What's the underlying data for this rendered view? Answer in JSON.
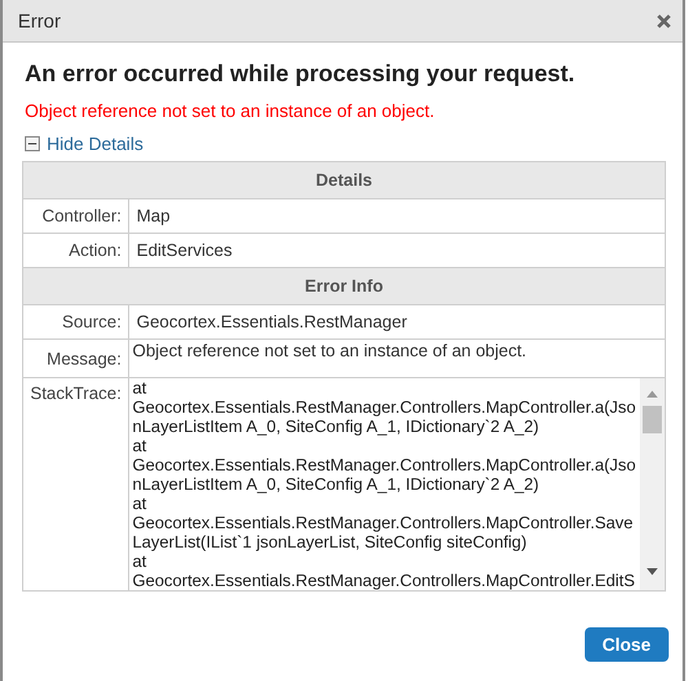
{
  "window": {
    "title": "Error"
  },
  "heading": "An error occurred while processing your request.",
  "message": "Object reference not set to an instance of an object.",
  "details_toggle": {
    "label": "Hide Details",
    "expanded": true
  },
  "sections": [
    {
      "title": "Details",
      "rows": [
        {
          "kind": "text",
          "label": "Controller:",
          "value": "Map"
        },
        {
          "kind": "text",
          "label": "Action:",
          "value": "EditServices"
        }
      ]
    },
    {
      "title": "Error Info",
      "rows": [
        {
          "kind": "text",
          "label": "Source:",
          "value": "Geocortex.Essentials.RestManager"
        },
        {
          "kind": "message",
          "label": "Message:",
          "value": "Object reference not set to an instance of an object."
        },
        {
          "kind": "trace",
          "label": "StackTrace:",
          "lines": [
            "at",
            "Geocortex.Essentials.RestManager.Controllers.MapController.a(Jso",
            "nLayerListItem A_0, SiteConfig A_1, IDictionary`2 A_2)",
            "at",
            "Geocortex.Essentials.RestManager.Controllers.MapController.a(Jso",
            "nLayerListItem A_0, SiteConfig A_1, IDictionary`2 A_2)",
            "at",
            "Geocortex.Essentials.RestManager.Controllers.MapController.Save",
            "LayerList(IList`1 jsonLayerList, SiteConfig siteConfig)",
            "at",
            "Geocortex.Essentials.RestManager.Controllers.MapController.EditS"
          ]
        }
      ]
    }
  ],
  "buttons": [
    "Close"
  ]
}
